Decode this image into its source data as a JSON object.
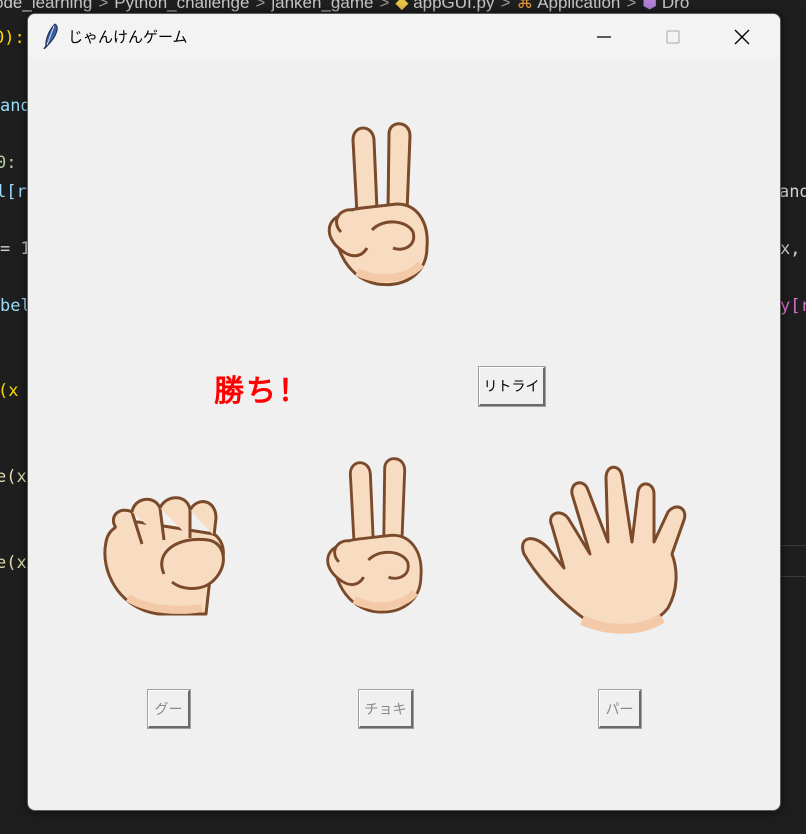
{
  "background_editor": {
    "breadcrumb": [
      "ode_learning",
      "Python_challenge",
      "janken_game",
      "appGUI.py",
      "Application",
      "Dro"
    ],
    "code_fragments": [
      "0):",
      "and",
      "0:",
      "l[r",
      "= 1",
      "bel",
      "(x",
      "e(x",
      "e(x",
      "andC",
      "x,",
      "y[ra"
    ]
  },
  "window": {
    "title": "じゃんけんゲーム",
    "icon": "feather-icon",
    "controls": [
      "minimize-icon",
      "maximize-icon",
      "close-icon"
    ]
  },
  "game": {
    "computer_hand": "choki",
    "result_text": "勝ち！",
    "result_color": "#ff0000",
    "retry_label": "リトライ",
    "choices": [
      {
        "hand": "gu",
        "label": "グー",
        "enabled": false
      },
      {
        "hand": "choki",
        "label": "チョキ",
        "enabled": false
      },
      {
        "hand": "pa",
        "label": "パー",
        "enabled": false
      }
    ]
  }
}
